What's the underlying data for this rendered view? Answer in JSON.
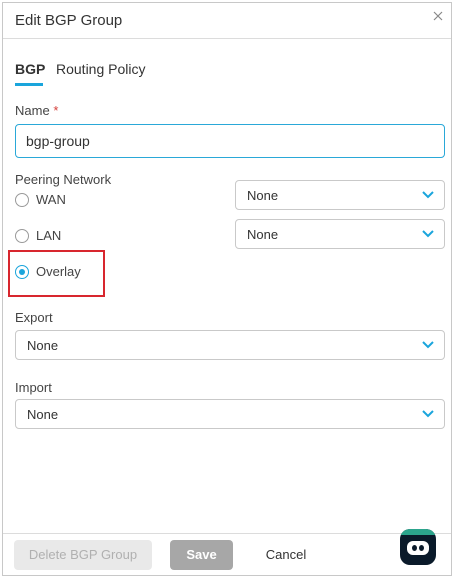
{
  "dialog": {
    "title": "Edit BGP Group",
    "close_icon": "close-icon"
  },
  "tabs": [
    {
      "label": "BGP",
      "active": true
    },
    {
      "label": "Routing Policy",
      "active": false
    }
  ],
  "name_field": {
    "label": "Name",
    "required_marker": "*",
    "value": "bgp-group"
  },
  "peering": {
    "label": "Peering Network",
    "options": [
      {
        "label": "WAN",
        "checked": false,
        "select_value": "None"
      },
      {
        "label": "LAN",
        "checked": false,
        "select_value": "None"
      },
      {
        "label": "Overlay",
        "checked": true
      }
    ]
  },
  "export": {
    "label": "Export",
    "value": "None"
  },
  "import": {
    "label": "Import",
    "value": "None"
  },
  "footer": {
    "delete_label": "Delete BGP Group",
    "save_label": "Save",
    "cancel_label": "Cancel"
  },
  "colors": {
    "accent": "#1aa5dc",
    "highlight": "#d8262e",
    "save_button": "#a7a7a7",
    "chat_bot": "#0a1a2a"
  },
  "chat_widget": {
    "icon": "chat-bot-icon"
  }
}
